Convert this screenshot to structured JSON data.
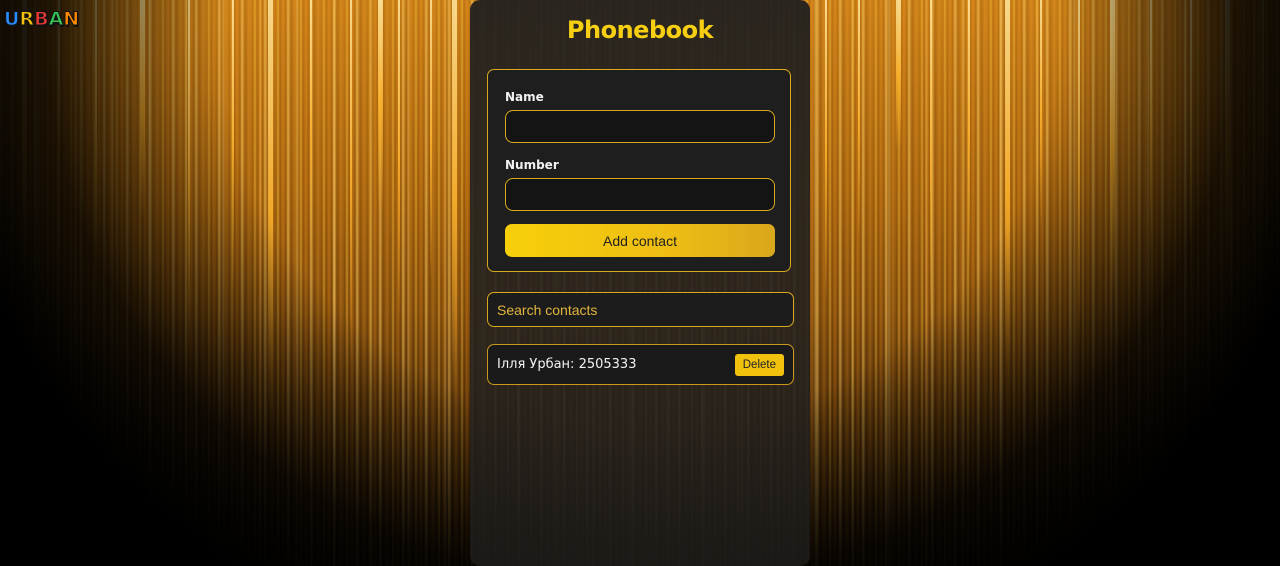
{
  "logo": {
    "letters": [
      {
        "char": "U",
        "color": "#2b8cff"
      },
      {
        "char": "R",
        "color": "#f4c20d"
      },
      {
        "char": "B",
        "color": "#e53935"
      },
      {
        "char": "A",
        "color": "#34c759"
      },
      {
        "char": "N",
        "color": "#ff8a00"
      }
    ]
  },
  "app": {
    "title": "Phonebook"
  },
  "form": {
    "name_label": "Name",
    "name_value": "",
    "number_label": "Number",
    "number_value": "",
    "submit_label": "Add contact"
  },
  "search": {
    "placeholder": "Search contacts",
    "value": ""
  },
  "contacts": [
    {
      "text": "Ілля Урбан: 2505333",
      "delete_label": "Delete"
    }
  ],
  "colors": {
    "accent": "#f7cf12",
    "border": "#d9a91e",
    "panel": "#1e1e1e"
  }
}
